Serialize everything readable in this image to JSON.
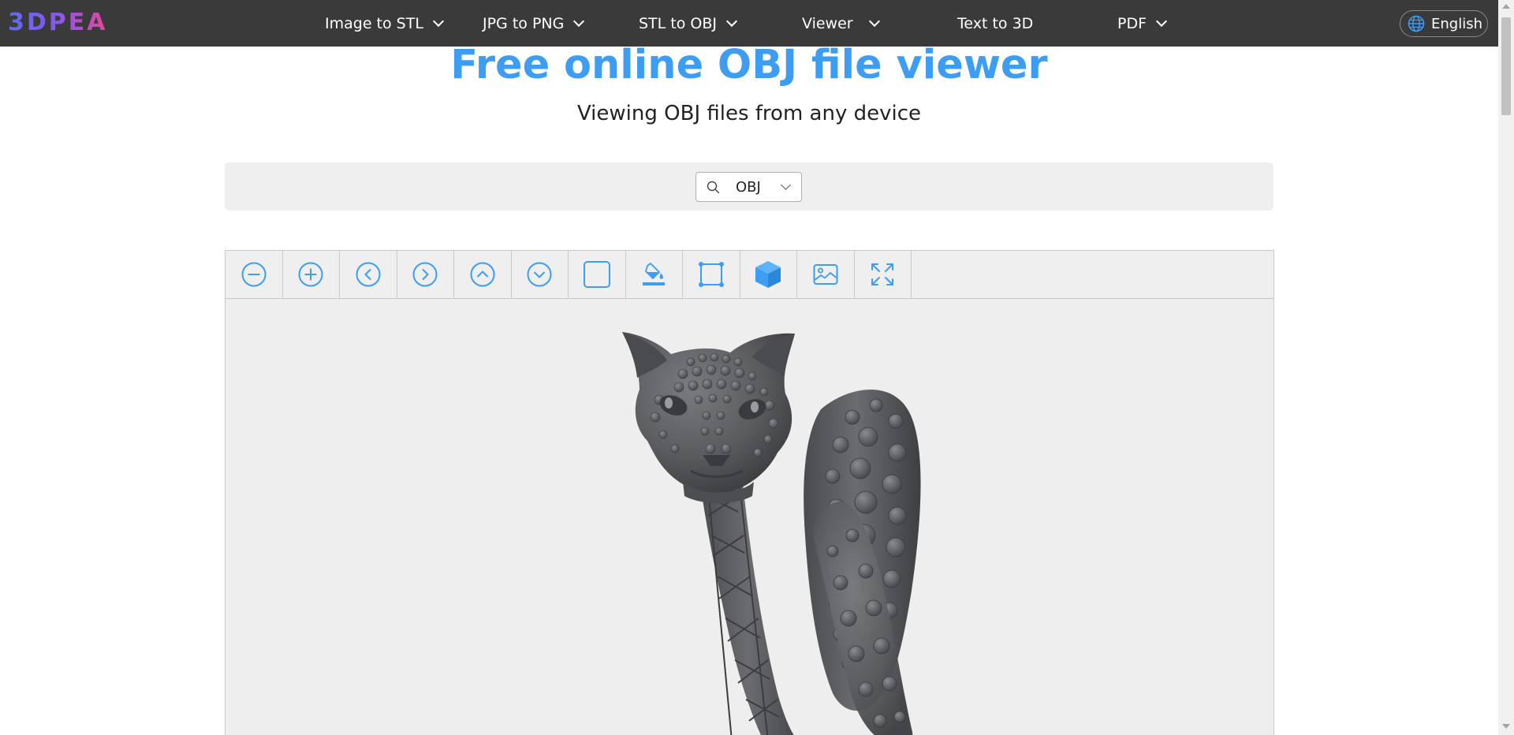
{
  "logo": {
    "text": "3DPEA"
  },
  "nav": {
    "items": [
      {
        "label": "Image to STL",
        "has_dropdown": true
      },
      {
        "label": "JPG to PNG",
        "has_dropdown": true
      },
      {
        "label": "STL to OBJ",
        "has_dropdown": true
      },
      {
        "label": "Viewer",
        "has_dropdown": true
      },
      {
        "label": "Text to 3D",
        "has_dropdown": false
      },
      {
        "label": "PDF",
        "has_dropdown": true
      }
    ],
    "language": {
      "label": "English",
      "icon": "globe-icon"
    }
  },
  "hero": {
    "title": "Free online OBJ file viewer",
    "subtitle": "Viewing OBJ files from any device"
  },
  "format_selector": {
    "icon": "search-icon",
    "selected": "OBJ"
  },
  "toolbar": {
    "tools": [
      {
        "name": "zoom-out",
        "icon": "minus-circle-icon"
      },
      {
        "name": "zoom-in",
        "icon": "plus-circle-icon"
      },
      {
        "name": "rotate-left",
        "icon": "chevron-left-circle-icon"
      },
      {
        "name": "rotate-right",
        "icon": "chevron-right-circle-icon"
      },
      {
        "name": "rotate-up",
        "icon": "chevron-up-circle-icon"
      },
      {
        "name": "rotate-down",
        "icon": "chevron-down-circle-icon"
      },
      {
        "name": "background",
        "icon": "square-icon"
      },
      {
        "name": "color",
        "icon": "paint-bucket-icon"
      },
      {
        "name": "bounding-box",
        "icon": "bounding-box-icon"
      },
      {
        "name": "solid-view",
        "icon": "cube-icon"
      },
      {
        "name": "screenshot",
        "icon": "image-icon"
      },
      {
        "name": "fullscreen",
        "icon": "expand-icon"
      }
    ]
  },
  "colors": {
    "topbar": "#3a3a3a",
    "accent": "#3d9df3",
    "model": "#5a5b5e",
    "viewer_bg": "#eeeeee"
  },
  "model": {
    "icon": "leopard-ring-model"
  }
}
